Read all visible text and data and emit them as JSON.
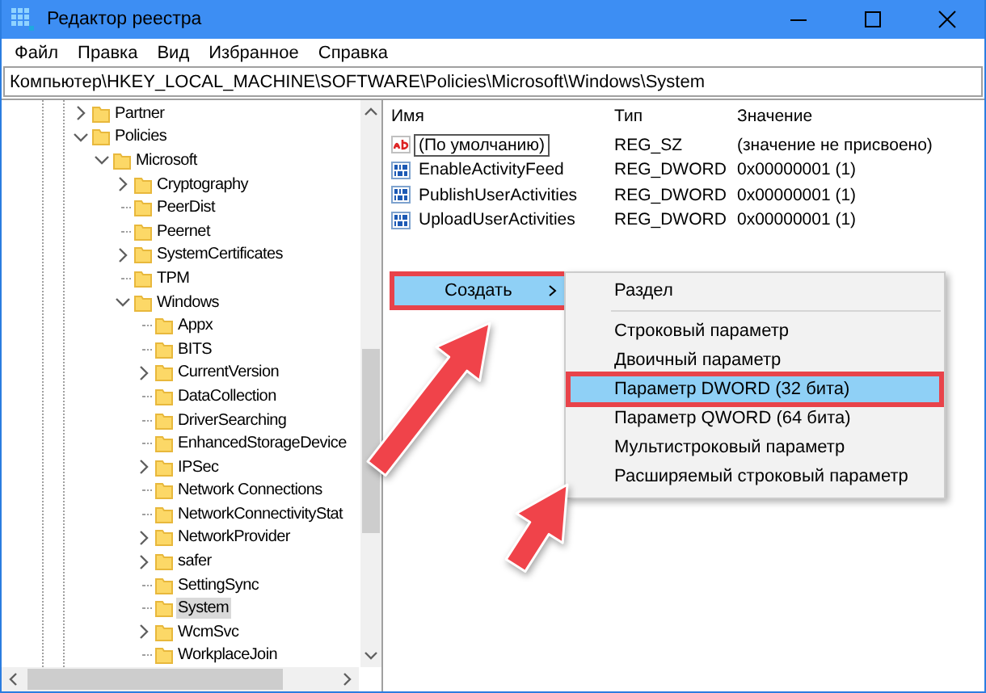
{
  "window": {
    "title": "Редактор реестра"
  },
  "menu": [
    "Файл",
    "Правка",
    "Вид",
    "Избранное",
    "Справка"
  ],
  "address": "Компьютер\\HKEY_LOCAL_MACHINE\\SOFTWARE\\Policies\\Microsoft\\Windows\\System",
  "tree": [
    {
      "label": "Partner",
      "expandable": true,
      "expanded": false,
      "selected": false
    },
    {
      "label": "Policies",
      "expandable": true,
      "expanded": true,
      "selected": false,
      "children": [
        {
          "label": "Microsoft",
          "expandable": true,
          "expanded": true,
          "selected": false,
          "children": [
            {
              "label": "Cryptography",
              "expandable": true,
              "expanded": false,
              "selected": false
            },
            {
              "label": "PeerDist",
              "expandable": false,
              "selected": false
            },
            {
              "label": "Peernet",
              "expandable": false,
              "selected": false
            },
            {
              "label": "SystemCertificates",
              "expandable": true,
              "expanded": false,
              "selected": false
            },
            {
              "label": "TPM",
              "expandable": false,
              "selected": false
            },
            {
              "label": "Windows",
              "expandable": true,
              "expanded": true,
              "selected": false,
              "children": [
                {
                  "label": "Appx",
                  "expandable": false,
                  "selected": false
                },
                {
                  "label": "BITS",
                  "expandable": false,
                  "selected": false
                },
                {
                  "label": "CurrentVersion",
                  "expandable": true,
                  "expanded": false,
                  "selected": false
                },
                {
                  "label": "DataCollection",
                  "expandable": false,
                  "selected": false
                },
                {
                  "label": "DriverSearching",
                  "expandable": false,
                  "selected": false
                },
                {
                  "label": "EnhancedStorageDevice",
                  "expandable": false,
                  "selected": false
                },
                {
                  "label": "IPSec",
                  "expandable": true,
                  "expanded": false,
                  "selected": false
                },
                {
                  "label": "Network Connections",
                  "expandable": false,
                  "selected": false
                },
                {
                  "label": "NetworkConnectivityStat",
                  "expandable": false,
                  "selected": false
                },
                {
                  "label": "NetworkProvider",
                  "expandable": true,
                  "expanded": false,
                  "selected": false
                },
                {
                  "label": "safer",
                  "expandable": true,
                  "expanded": false,
                  "selected": false
                },
                {
                  "label": "SettingSync",
                  "expandable": false,
                  "selected": false
                },
                {
                  "label": "System",
                  "expandable": false,
                  "selected": true
                },
                {
                  "label": "WcmSvc",
                  "expandable": true,
                  "expanded": false,
                  "selected": false
                },
                {
                  "label": "WorkplaceJoin",
                  "expandable": false,
                  "selected": false
                }
              ]
            }
          ]
        }
      ]
    }
  ],
  "values": {
    "columns": [
      "Имя",
      "Тип",
      "Значение"
    ],
    "rows": [
      {
        "kind": "string",
        "name": "(По умолчанию)",
        "type": "REG_SZ",
        "data": "(значение не присвоено)",
        "focused": true
      },
      {
        "kind": "binary",
        "name": "EnableActivityFeed",
        "type": "REG_DWORD",
        "data": "0x00000001 (1)",
        "focused": false
      },
      {
        "kind": "binary",
        "name": "PublishUserActivities",
        "type": "REG_DWORD",
        "data": "0x00000001 (1)",
        "focused": false
      },
      {
        "kind": "binary",
        "name": "UploadUserActivities",
        "type": "REG_DWORD",
        "data": "0x00000001 (1)",
        "focused": false
      }
    ]
  },
  "context_menu": {
    "items": [
      {
        "label": "Создать",
        "selected": true,
        "annotated": true
      }
    ]
  },
  "submenu": {
    "items": [
      {
        "kind": "item",
        "label": "Раздел",
        "selected": false,
        "annotated": false
      },
      {
        "kind": "separator"
      },
      {
        "kind": "item",
        "label": "Строковый параметр",
        "selected": false,
        "annotated": false
      },
      {
        "kind": "item",
        "label": "Двоичный параметр",
        "selected": false,
        "annotated": false
      },
      {
        "kind": "item",
        "label": "Параметр DWORD (32 бита)",
        "selected": true,
        "annotated": true
      },
      {
        "kind": "item",
        "label": "Параметр QWORD (64 бита)",
        "selected": false,
        "annotated": false
      },
      {
        "kind": "item",
        "label": "Мультистроковый параметр",
        "selected": false,
        "annotated": false
      },
      {
        "kind": "item",
        "label": "Расширяемый строковый параметр",
        "selected": false,
        "annotated": false
      }
    ]
  }
}
